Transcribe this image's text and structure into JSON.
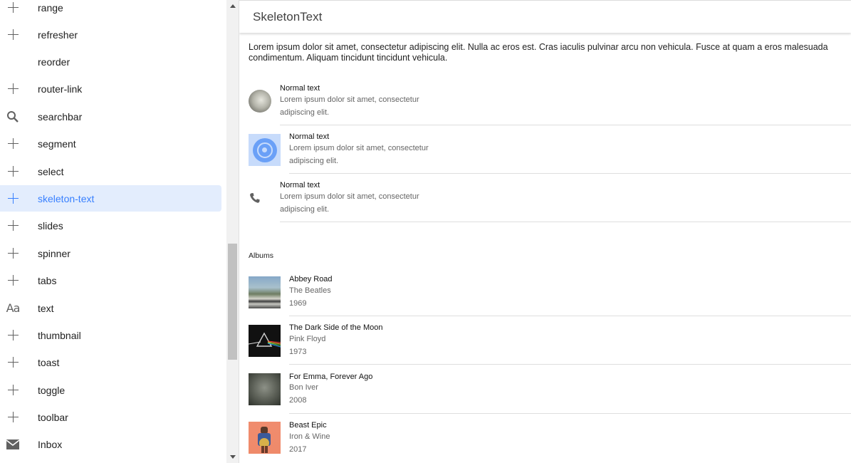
{
  "sidebar": {
    "items": [
      {
        "label": "range",
        "icon": "plus-icon"
      },
      {
        "label": "refresher",
        "icon": "plus-icon"
      },
      {
        "label": "reorder",
        "icon": ""
      },
      {
        "label": "router-link",
        "icon": "plus-icon"
      },
      {
        "label": "searchbar",
        "icon": "search-icon"
      },
      {
        "label": "segment",
        "icon": "plus-icon"
      },
      {
        "label": "select",
        "icon": "plus-icon"
      },
      {
        "label": "skeleton-text",
        "icon": "plus-icon",
        "active": true
      },
      {
        "label": "slides",
        "icon": "plus-icon"
      },
      {
        "label": "spinner",
        "icon": "plus-icon"
      },
      {
        "label": "tabs",
        "icon": "plus-icon"
      },
      {
        "label": "text",
        "icon": "text-aa-icon",
        "icon_glyph": "Aa"
      },
      {
        "label": "thumbnail",
        "icon": "plus-icon"
      },
      {
        "label": "toast",
        "icon": "plus-icon"
      },
      {
        "label": "toggle",
        "icon": "plus-icon"
      },
      {
        "label": "toolbar",
        "icon": "plus-icon"
      },
      {
        "label": "Inbox",
        "icon": "mail-icon"
      }
    ]
  },
  "toolbar": {
    "title": "SkeletonText"
  },
  "intro": "Lorem ipsum dolor sit amet, consectetur adipiscing elit. Nulla ac eros est. Cras iaculis pulvinar arcu non vehicula. Fusce at quam a eros malesuada condimentum. Aliquam tincidunt tincidunt vehicula.",
  "items": [
    {
      "title": "Normal text",
      "line1": "Lorem ipsum dolor sit amet, consectetur",
      "line2": "adipiscing elit.",
      "media": "avatar"
    },
    {
      "title": "Normal text",
      "line1": "Lorem ipsum dolor sit amet, consectetur",
      "line2": "adipiscing elit.",
      "media": "thumbnail"
    },
    {
      "title": "Normal text",
      "line1": "Lorem ipsum dolor sit amet, consectetur",
      "line2": "adipiscing elit.",
      "media": "phone-icon"
    }
  ],
  "albums_label": "Albums",
  "albums": [
    {
      "title": "Abbey Road",
      "artist": "The Beatles",
      "year": "1969"
    },
    {
      "title": "The Dark Side of the Moon",
      "artist": "Pink Floyd",
      "year": "1973"
    },
    {
      "title": "For Emma, Forever Ago",
      "artist": "Bon Iver",
      "year": "2008"
    },
    {
      "title": "Beast Epic",
      "artist": "Iron & Wine",
      "year": "2017"
    }
  ],
  "colors": {
    "accent": "#3880ff",
    "active_bg": "#e3edfd"
  }
}
